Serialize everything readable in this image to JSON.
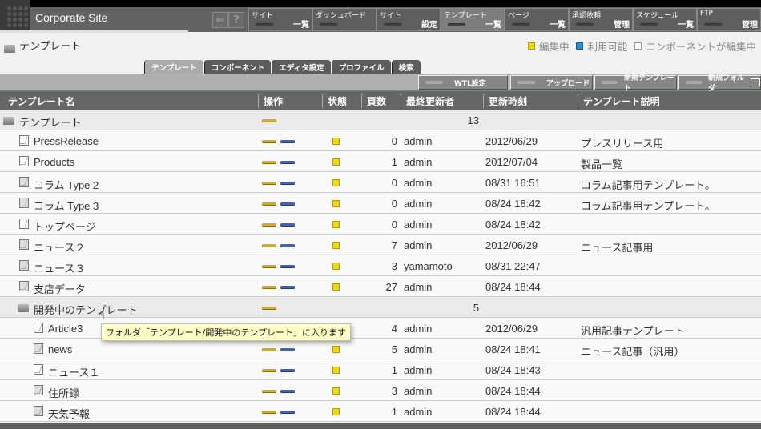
{
  "app": {
    "title": "Corporate Site",
    "icons": {
      "logout": "logout-icon",
      "help": "?"
    }
  },
  "nav": [
    {
      "top": "サイト",
      "bottom": "一覧"
    },
    {
      "top": "ダッシュボード",
      "bottom": ""
    },
    {
      "top": "サイト",
      "bottom": "設定"
    },
    {
      "top": "テンプレート",
      "bottom": "一覧",
      "active": true
    },
    {
      "top": "ページ",
      "bottom": "一覧"
    },
    {
      "top": "承認依頼",
      "bottom": "管理"
    },
    {
      "top": "スケジュール",
      "bottom": "一覧"
    },
    {
      "top": "FTP",
      "bottom": "管理"
    }
  ],
  "page": {
    "title": "テンプレート"
  },
  "legend": {
    "editing": "編集中",
    "available": "利用可能",
    "component_editing": "コンポーネントが編集中",
    "colors": {
      "editing": "#f5d800",
      "available": "#1e90e0",
      "component_editing": "#ffffff"
    }
  },
  "tabs": [
    {
      "label": "テンプレート",
      "active": true
    },
    {
      "label": "コンポーネント"
    },
    {
      "label": "エディタ設定"
    },
    {
      "label": "プロファイル"
    },
    {
      "label": "検索"
    }
  ],
  "toolbar": {
    "wtl": "WTL設定",
    "upload": "アップロード",
    "new_template": "新規テンプレート",
    "new_folder": "新規フォルダ"
  },
  "table": {
    "headers": {
      "name": "テンプレート名",
      "ops": "操作",
      "status": "状態",
      "pages": "頁数",
      "updater": "最終更新者",
      "updated": "更新時刻",
      "desc": "テンプレート説明"
    },
    "rows": [
      {
        "type": "folder",
        "name": "テンプレート",
        "pages": "13",
        "indent": 0
      },
      {
        "type": "doc",
        "name": "PressRelease",
        "pages": "0",
        "updater": "admin",
        "updated": "2012/06/29",
        "desc": "プレスリリース用",
        "indent": 1
      },
      {
        "type": "doc",
        "name": "Products",
        "pages": "1",
        "updater": "admin",
        "updated": "2012/07/04",
        "desc": "製品一覧",
        "indent": 1
      },
      {
        "type": "doc-gray",
        "name": "コラム Type 2",
        "pages": "0",
        "updater": "admin",
        "updated": "08/31 16:51",
        "desc": "コラム記事用テンプレート。",
        "indent": 1
      },
      {
        "type": "doc-gray",
        "name": "コラム Type 3",
        "pages": "0",
        "updater": "admin",
        "updated": "08/24 18:42",
        "desc": "コラム記事用テンプレート。",
        "indent": 1
      },
      {
        "type": "doc",
        "name": "トップページ",
        "pages": "0",
        "updater": "admin",
        "updated": "08/24 18:42",
        "desc": "",
        "indent": 1
      },
      {
        "type": "doc-gray",
        "name": "ニュース２",
        "pages": "7",
        "updater": "admin",
        "updated": "2012/06/29",
        "desc": "ニュース記事用",
        "indent": 1
      },
      {
        "type": "doc-gray",
        "name": "ニュース３",
        "pages": "3",
        "updater": "yamamoto",
        "updated": "08/31 22:47",
        "desc": "",
        "indent": 1
      },
      {
        "type": "doc-gray",
        "name": "支店データ",
        "pages": "27",
        "updater": "admin",
        "updated": "08/24 18:44",
        "desc": "",
        "indent": 1
      },
      {
        "type": "folder",
        "name": "開発中のテンプレート",
        "pages": "5",
        "indent": 1
      },
      {
        "type": "doc",
        "name": "Article3",
        "pages": "4",
        "updater": "admin",
        "updated": "2012/06/29",
        "desc": "汎用記事テンプレート",
        "indent": 2
      },
      {
        "type": "doc-gray",
        "name": "news",
        "pages": "5",
        "updater": "admin",
        "updated": "08/24 18:41",
        "desc": "ニュース記事（汎用）",
        "indent": 2
      },
      {
        "type": "doc",
        "name": "ニュース１",
        "pages": "1",
        "updater": "admin",
        "updated": "08/24 18:43",
        "desc": "",
        "indent": 2
      },
      {
        "type": "doc-gray",
        "name": "住所録",
        "pages": "3",
        "updater": "admin",
        "updated": "08/24 18:44",
        "desc": "",
        "indent": 2
      },
      {
        "type": "doc-gray",
        "name": "天気予報",
        "pages": "1",
        "updater": "admin",
        "updated": "08/24 18:44",
        "desc": "",
        "indent": 2
      }
    ]
  },
  "tooltip": "フォルダ「テンプレート/開発中のテンプレート」に入ります"
}
